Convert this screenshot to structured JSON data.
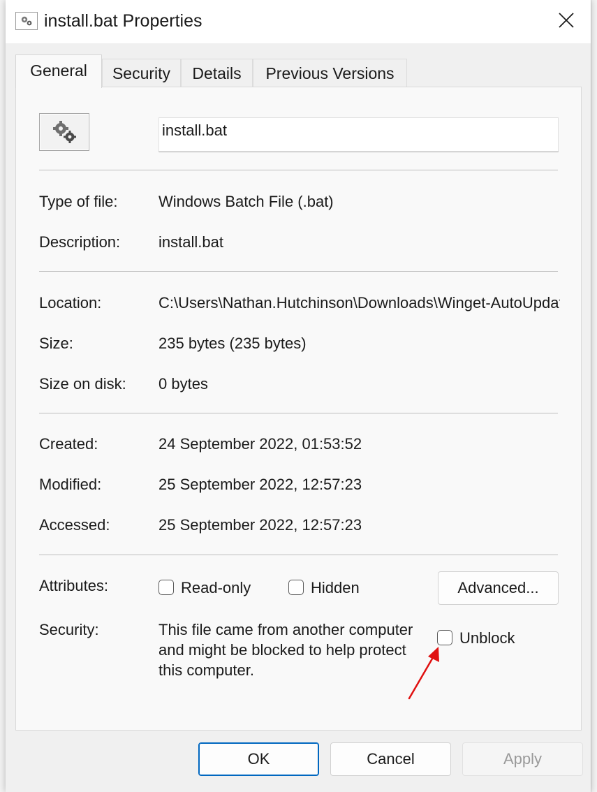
{
  "window": {
    "title": "install.bat Properties"
  },
  "tabs": [
    {
      "label": "General",
      "active": true
    },
    {
      "label": "Security",
      "active": false
    },
    {
      "label": "Details",
      "active": false
    },
    {
      "label": "Previous Versions",
      "active": false
    }
  ],
  "general": {
    "file_name": "install.bat",
    "type_label": "Type of file:",
    "type_value": "Windows Batch File (.bat)",
    "description_label": "Description:",
    "description_value": "install.bat",
    "location_label": "Location:",
    "location_value": "C:\\Users\\Nathan.Hutchinson\\Downloads\\Winget-AutoUpdate",
    "size_label": "Size:",
    "size_value": "235 bytes (235 bytes)",
    "size_on_disk_label": "Size on disk:",
    "size_on_disk_value": "0 bytes",
    "created_label": "Created:",
    "created_value": "24 September 2022, 01:53:52",
    "modified_label": "Modified:",
    "modified_value": "25 September 2022, 12:57:23",
    "accessed_label": "Accessed:",
    "accessed_value": "25 September 2022, 12:57:23",
    "attributes_label": "Attributes:",
    "readonly_label": "Read-only",
    "readonly_checked": false,
    "hidden_label": "Hidden",
    "hidden_checked": false,
    "advanced_label": "Advanced...",
    "security_label": "Security:",
    "security_text": "This file came from another computer and might be blocked to help protect this computer.",
    "unblock_label": "Unblock",
    "unblock_checked": false
  },
  "buttons": {
    "ok": "OK",
    "cancel": "Cancel",
    "apply": "Apply"
  },
  "icons": {
    "window": "gears-file-icon",
    "file": "gears-file-icon",
    "close": "close-icon",
    "annotation": "red-arrow-annotation"
  },
  "colors": {
    "accent": "#0067c0",
    "annotation_arrow": "#e01010",
    "dialog_bg": "#f0f0f0",
    "panel_bg": "#f9f9f9"
  }
}
